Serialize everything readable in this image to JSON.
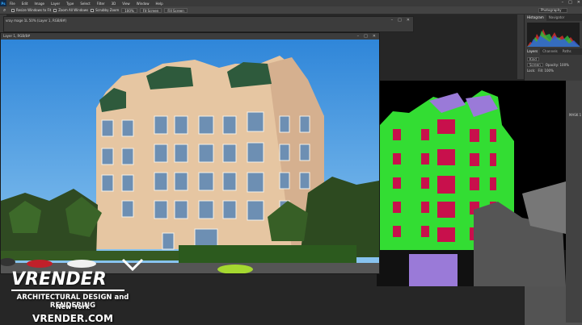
{
  "app": {
    "logo_text": "Ps",
    "menus": [
      "File",
      "Edit",
      "Image",
      "Layer",
      "Type",
      "Select",
      "Filter",
      "3D",
      "View",
      "Window",
      "Help"
    ],
    "win_controls": [
      "–",
      "□",
      "✕"
    ]
  },
  "options_bar": {
    "tool_icon": "zoom-icon",
    "resize_windows": "Resize Windows to Fit",
    "zoom_all_windows": "Zoom All Windows",
    "scrubby_zoom": "Scrubby Zoom",
    "zoom_100": "100%",
    "fit_screen": "Fit Screen",
    "fill_screen": "Fill Screen",
    "workspace": "Photography"
  },
  "documents": {
    "back_tab": "vray mage 1L 50% (Layer 1, RGB/8#)",
    "front_tab": "Layer 1, RGB/8#"
  },
  "panels": {
    "tabs_top": [
      "Histogram",
      "Navigator"
    ],
    "tabs_layers": [
      "Layers",
      "Channels",
      "Paths"
    ],
    "kind_label": "Kind",
    "blend_mode": "Screen",
    "opacity_label": "Opacity: 100%",
    "lock_label": "Lock:",
    "fill_label": "Fill: 100%",
    "side_label": "MASK 1"
  },
  "watermark": {
    "brand": "VRENDER",
    "tagline": "ARCHITECTURAL DESIGN and RENDERING",
    "city": "New York",
    "website": "VRENDER.COM"
  },
  "colors": {
    "sky": "#4f9fe0",
    "facade": "#e8c9a6",
    "mask_green": "#33dd33",
    "mask_magenta": "#c8104c",
    "mask_purple": "#9a7ad8"
  }
}
